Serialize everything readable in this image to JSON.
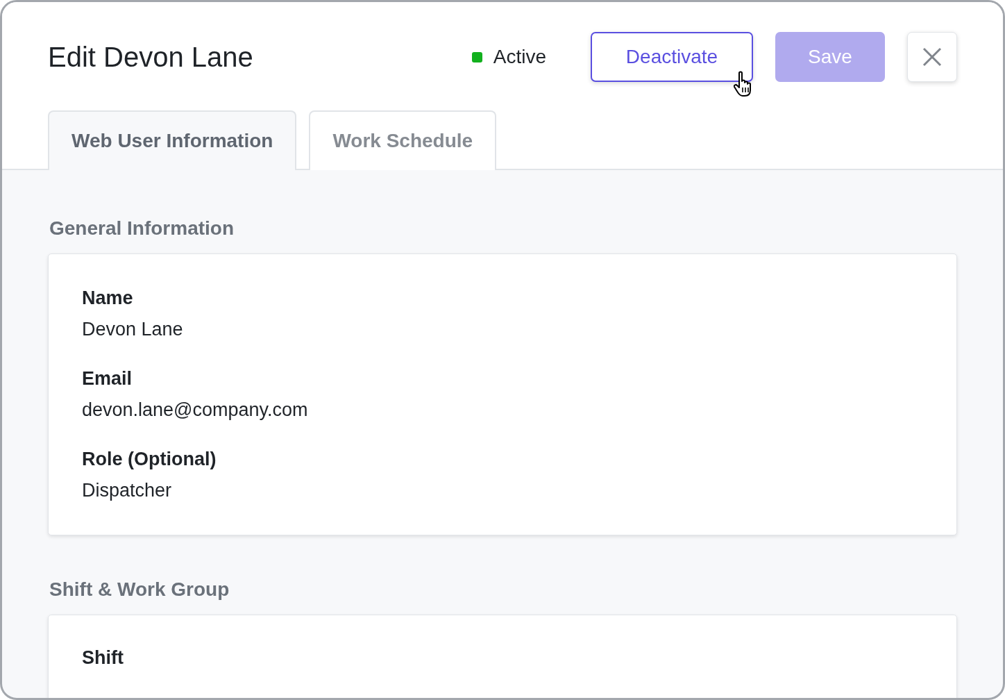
{
  "dialog": {
    "title": "Edit Devon Lane"
  },
  "status": {
    "label": "Active",
    "color": "#12b01e"
  },
  "buttons": [
    {
      "kind": "outline",
      "label": "Deactivate",
      "hovered": true
    },
    {
      "kind": "primary",
      "label": "Save",
      "disabled": true
    },
    {
      "kind": "close"
    }
  ],
  "tabs": [
    {
      "label": "Web User Information",
      "selected": true
    },
    {
      "label": "Work Schedule",
      "selected": false
    }
  ],
  "sections": [
    {
      "title": "General Information",
      "fields": [
        {
          "label": "Name",
          "value": "Devon Lane"
        },
        {
          "label": "Email",
          "value": "devon.lane@company.com"
        },
        {
          "label": "Role (Optional)",
          "value": "Dispatcher"
        }
      ]
    },
    {
      "title": "Shift & Work Group",
      "fields": [
        {
          "label": "Shift"
        }
      ]
    }
  ]
}
